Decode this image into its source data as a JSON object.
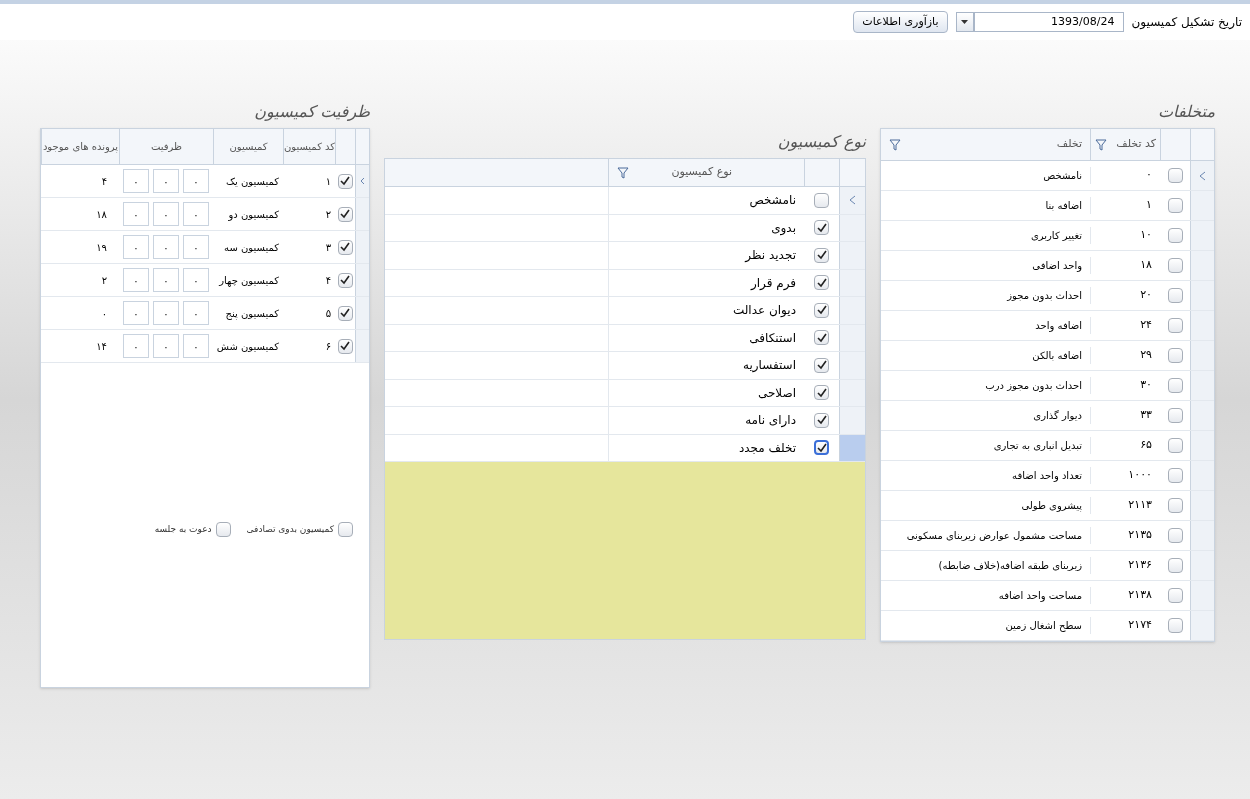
{
  "top_bar": {
    "label": "تاریخ تشکیل کمیسیون",
    "date_value": "1393/08/24",
    "refresh_button": "بازآوری اطلاعات"
  },
  "violations": {
    "title": "متخلفات",
    "columns": [
      "کد تخلف",
      "تخلف"
    ],
    "rows": [
      {
        "code": "۰",
        "name": "نامشخص",
        "checked": false
      },
      {
        "code": "۱",
        "name": "اضافه بنا",
        "checked": false
      },
      {
        "code": "۱۰",
        "name": "تغییر کاربری",
        "checked": false
      },
      {
        "code": "۱۸",
        "name": "واحد اضافی",
        "checked": false
      },
      {
        "code": "۲۰",
        "name": "احداث بدون مجوز",
        "checked": false
      },
      {
        "code": "۲۴",
        "name": "اضافه واحد",
        "checked": false
      },
      {
        "code": "۲۹",
        "name": "اضافه بالکن",
        "checked": false
      },
      {
        "code": "۳۰",
        "name": "احداث بدون مجوز درب",
        "checked": false
      },
      {
        "code": "۳۳",
        "name": "دیوار گذاری",
        "checked": false
      },
      {
        "code": "۶۵",
        "name": "تبدیل انباری به تجاری",
        "checked": false
      },
      {
        "code": "۱۰۰۰",
        "name": "تعداد واحد اضافه",
        "checked": false
      },
      {
        "code": "۲۱۱۳",
        "name": "پیشروی طولی",
        "checked": false
      },
      {
        "code": "۲۱۳۵",
        "name": "مساحت مشمول عوارض زیربنای مسکونی",
        "checked": false
      },
      {
        "code": "۲۱۳۶",
        "name": "زیربنای طبقه اضافه(خلاف ضابطه)",
        "checked": false
      },
      {
        "code": "۲۱۳۸",
        "name": "مساحت واحد اضافه",
        "checked": false
      },
      {
        "code": "۲۱۷۴",
        "name": "سطح اشغال زمین",
        "checked": false
      }
    ]
  },
  "commission_types": {
    "title": "نوع کمیسیون",
    "column": "نوع کمیسیون",
    "rows": [
      {
        "name": "نامشخص",
        "checked": false,
        "selected": false
      },
      {
        "name": "بدوی",
        "checked": true,
        "selected": false
      },
      {
        "name": "تجدید نظر",
        "checked": true,
        "selected": false
      },
      {
        "name": "فرم قرار",
        "checked": true,
        "selected": false
      },
      {
        "name": "دیوان عدالت",
        "checked": true,
        "selected": false
      },
      {
        "name": "استنکافی",
        "checked": true,
        "selected": false
      },
      {
        "name": "استفساریه",
        "checked": true,
        "selected": false
      },
      {
        "name": "اصلاحی",
        "checked": true,
        "selected": false
      },
      {
        "name": "دارای نامه",
        "checked": true,
        "selected": false
      },
      {
        "name": "تخلف مجدد",
        "checked": true,
        "selected": true
      }
    ]
  },
  "capacity": {
    "title": "ظرفیت کمیسیون",
    "columns": [
      "کد کمیسیون",
      "کمیسیون",
      "ظرفیت",
      "پرونده های موجود"
    ],
    "rows": [
      {
        "code": "۱",
        "name": "کمیسیون یک",
        "checked": true,
        "capacity": [
          "۰",
          "۰",
          "۰"
        ],
        "files": "۴"
      },
      {
        "code": "۲",
        "name": "کمیسیون دو",
        "checked": true,
        "capacity": [
          "۰",
          "۰",
          "۰"
        ],
        "files": "۱۸"
      },
      {
        "code": "۳",
        "name": "کمیسیون سه",
        "checked": true,
        "capacity": [
          "۰",
          "۰",
          "۰"
        ],
        "files": "۱۹"
      },
      {
        "code": "۴",
        "name": "کمیسیون چهار",
        "checked": true,
        "capacity": [
          "۰",
          "۰",
          "۰"
        ],
        "files": "۲"
      },
      {
        "code": "۵",
        "name": "کمیسیون پنج",
        "checked": true,
        "capacity": [
          "۰",
          "۰",
          "۰"
        ],
        "files": "۰"
      },
      {
        "code": "۶",
        "name": "کمیسیون شش",
        "checked": true,
        "capacity": [
          "۰",
          "۰",
          "۰"
        ],
        "files": "۱۴"
      }
    ],
    "options": [
      {
        "label": "کمیسیون بدوی تصادفی",
        "checked": false
      },
      {
        "label": "دعوت به جلسه",
        "checked": false
      }
    ]
  }
}
